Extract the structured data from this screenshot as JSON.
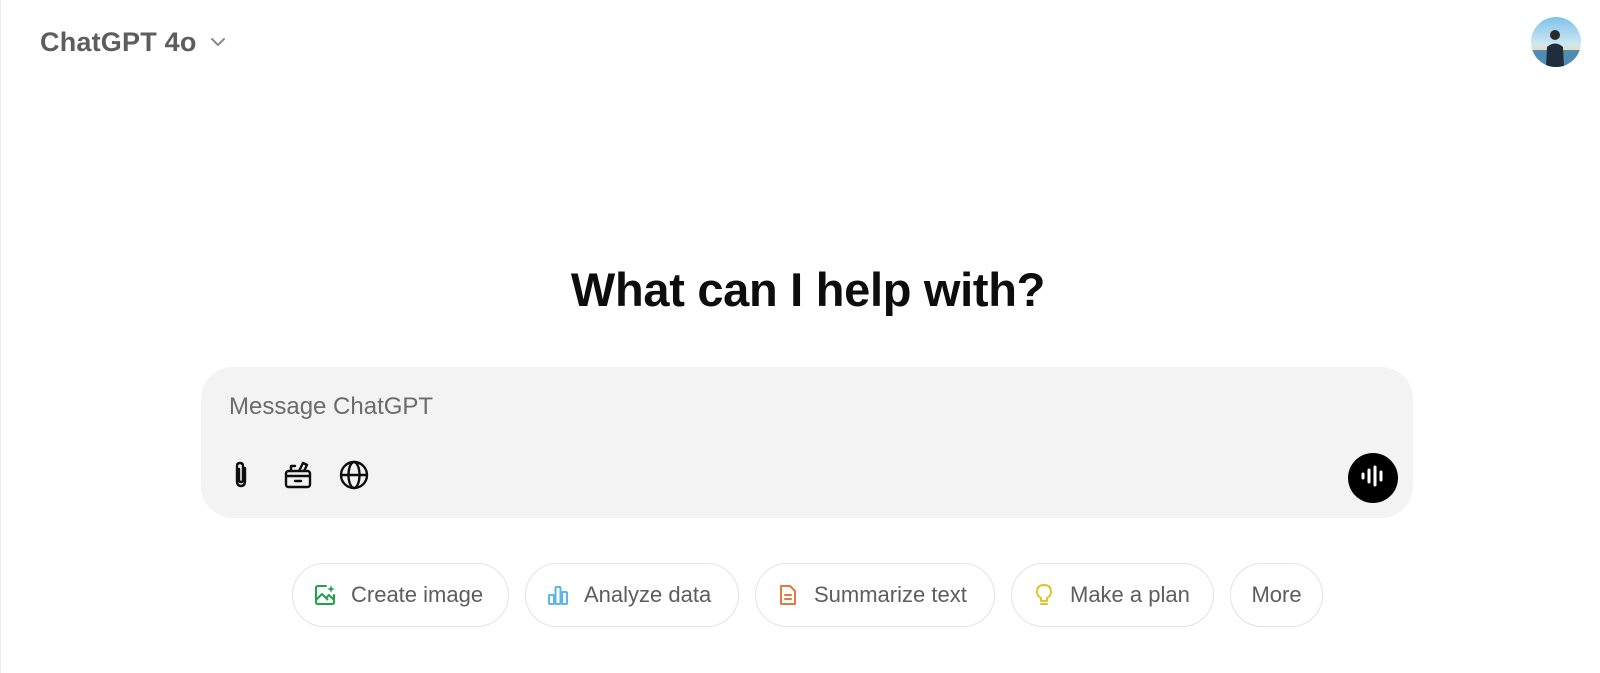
{
  "header": {
    "model_name": "ChatGPT 4o",
    "model_icon": "chevron-down-icon",
    "avatar_icon": "user-avatar"
  },
  "main": {
    "title": "What can I help with?"
  },
  "composer": {
    "placeholder": "Message ChatGPT",
    "value": "",
    "tools": [
      {
        "name": "attach",
        "icon": "paperclip-icon"
      },
      {
        "name": "tools",
        "icon": "toolbox-icon"
      },
      {
        "name": "search",
        "icon": "globe-icon"
      }
    ],
    "voice_icon": "voice-waveform-icon"
  },
  "suggestions": [
    {
      "label": "Create image",
      "icon": "create-image-icon",
      "color": "#1fa34a"
    },
    {
      "label": "Analyze data",
      "icon": "bar-chart-icon",
      "color": "#5bb5e6"
    },
    {
      "label": "Summarize text",
      "icon": "document-icon",
      "color": "#e8773d"
    },
    {
      "label": "Make a plan",
      "icon": "lightbulb-icon",
      "color": "#e2c32e"
    },
    {
      "label": "More",
      "icon": "",
      "color": ""
    }
  ],
  "colors": {
    "composer_bg": "#f3f3f3",
    "voice_button_bg": "#000000",
    "chip_border": "#e3e3e3",
    "muted_text": "#5d5d5d"
  }
}
